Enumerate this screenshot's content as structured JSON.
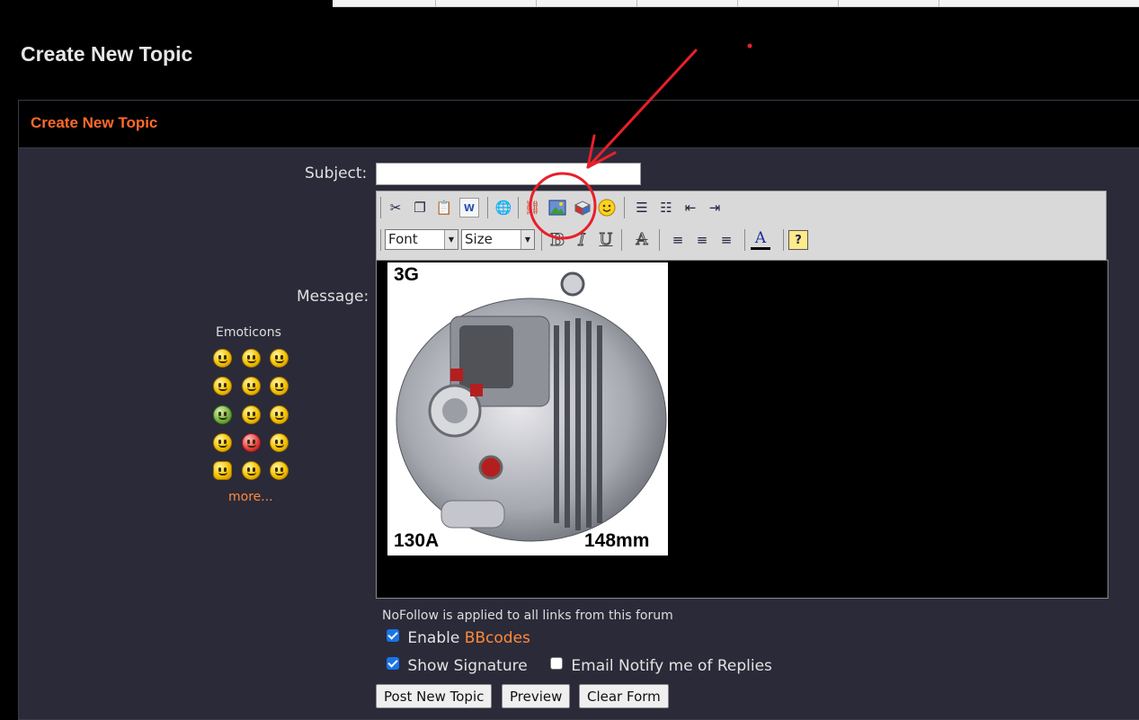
{
  "page": {
    "title": "Create New Topic"
  },
  "panel": {
    "header": "Create New Topic"
  },
  "form": {
    "subject_label": "Subject:",
    "subject_value": "",
    "message_label": "Message:"
  },
  "toolbar": {
    "row1_icons": [
      "cut-icon",
      "copy-icon",
      "paste-icon",
      "paste-word-icon",
      "insert-link-icon",
      "unlink-icon",
      "insert-image-icon",
      "insert-flash-icon",
      "emoticon-icon",
      "ordered-list-icon",
      "unordered-list-icon",
      "outdent-icon",
      "indent-icon"
    ],
    "font_label": "Font",
    "size_label": "Size",
    "row2_icons": [
      "bold-icon",
      "italic-icon",
      "underline-icon",
      "strikethrough-icon",
      "align-left-icon",
      "align-center-icon",
      "align-right-icon",
      "text-color-icon",
      "help-icon"
    ]
  },
  "editor_image": {
    "top_left": "3G",
    "bottom_left": "130A",
    "bottom_right": "148mm"
  },
  "emoticons": {
    "title": "Emoticons",
    "more": "more..."
  },
  "options": {
    "nofollow": "NoFollow is applied to all links from this forum",
    "enable_label": "Enable",
    "bbcodes_link": "BBcodes",
    "enable_checked": true,
    "show_signature": "Show Signature",
    "show_signature_checked": true,
    "email_notify": "Email Notify me of Replies",
    "email_notify_checked": false
  },
  "buttons": {
    "post": "Post New Topic",
    "preview": "Preview",
    "clear": "Clear Form"
  },
  "colors": {
    "accent": "#ff6a2b",
    "link": "#ff8a3a",
    "annotation": "#e8202a"
  }
}
